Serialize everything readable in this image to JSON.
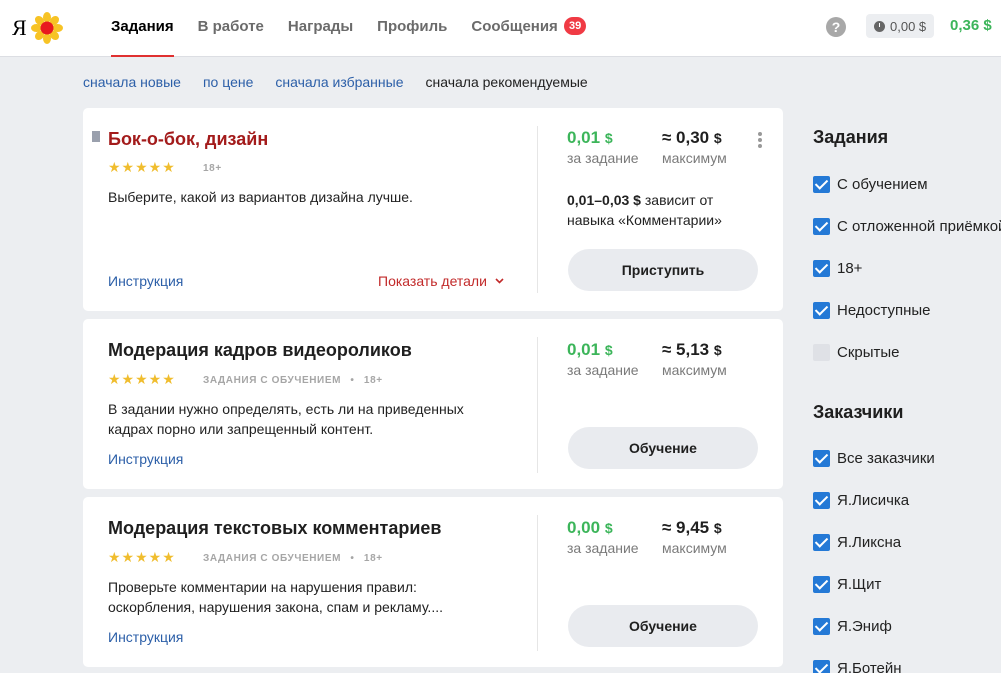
{
  "header": {
    "logo_letter": "Я",
    "nav": [
      {
        "label": "Задания",
        "active": true
      },
      {
        "label": "В работе",
        "active": false
      },
      {
        "label": "Награды",
        "active": false
      },
      {
        "label": "Профиль",
        "active": false
      },
      {
        "label": "Сообщения",
        "active": false,
        "badge": "39"
      }
    ],
    "help": "?",
    "balance": "0,00 $",
    "earnings": "0,36 $"
  },
  "sort": [
    {
      "label": "сначала новые",
      "active": false
    },
    {
      "label": "по цене",
      "active": false
    },
    {
      "label": "сначала избранные",
      "active": false
    },
    {
      "label": "сначала рекомендуемые",
      "active": true
    }
  ],
  "tasks": [
    {
      "title": "Бок-о-бок, дизайн",
      "stars": "★★★★★",
      "meta": "18+",
      "description": "Выберите, какой из вариантов дизайна лучше.",
      "instruction": "Инструкция",
      "details": "Показать детали",
      "price": "0,01",
      "price_label": "за задание",
      "max_value": "≈ 0,30",
      "max_label": "максимум",
      "currency": "$",
      "skill_amount": "0,01–0,03 $",
      "skill_text": " зависит от навыка «Комментарии»",
      "action": "Приступить"
    },
    {
      "title": "Модерация кадров видеороликов",
      "stars": "★★★★★",
      "meta_training": "ЗАДАНИЯ С ОБУЧЕНИЕМ",
      "meta_sep": "•",
      "meta": "18+",
      "description": "В задании нужно определять, есть ли на приведенных кадрах порно или запрещенный контент.",
      "instruction": "Инструкция",
      "price": "0,01",
      "price_label": "за задание",
      "max_value": "≈ 5,13",
      "max_label": "максимум",
      "currency": "$",
      "action": "Обучение"
    },
    {
      "title": "Модерация текстовых комментариев",
      "stars": "★★★★★",
      "meta_training": "ЗАДАНИЯ С ОБУЧЕНИЕМ",
      "meta_sep": "•",
      "meta": "18+",
      "description": "Проверьте комментарии на нарушения правил: оскорбления, нарушения закона, спам и рекламу....",
      "instruction": "Инструкция",
      "price": "0,00",
      "price_label": "за задание",
      "max_value": "≈ 9,45",
      "max_label": "максимум",
      "currency": "$",
      "action": "Обучение"
    }
  ],
  "filters": {
    "tasks_title": "Задания",
    "task_filters": [
      {
        "label": "С обучением",
        "checked": true
      },
      {
        "label": "С отложенной приёмкой",
        "checked": true
      },
      {
        "label": "18+",
        "checked": true
      },
      {
        "label": "Недоступные",
        "checked": true
      },
      {
        "label": "Скрытые",
        "checked": false
      }
    ],
    "requesters_title": "Заказчики",
    "requesters": [
      {
        "label": "Все заказчики",
        "checked": true
      },
      {
        "label": "Я.Лисичка",
        "checked": true
      },
      {
        "label": "Я.Ликсна",
        "checked": true
      },
      {
        "label": "Я.Щит",
        "checked": true
      },
      {
        "label": "Я.Эниф",
        "checked": true
      },
      {
        "label": "Я.Ботейн",
        "checked": true
      }
    ]
  },
  "colors": {
    "accent_red": "#e03030",
    "money_green": "#3cb55a",
    "link_blue": "#2c5fa8",
    "checkbox_blue": "#2479d6"
  }
}
